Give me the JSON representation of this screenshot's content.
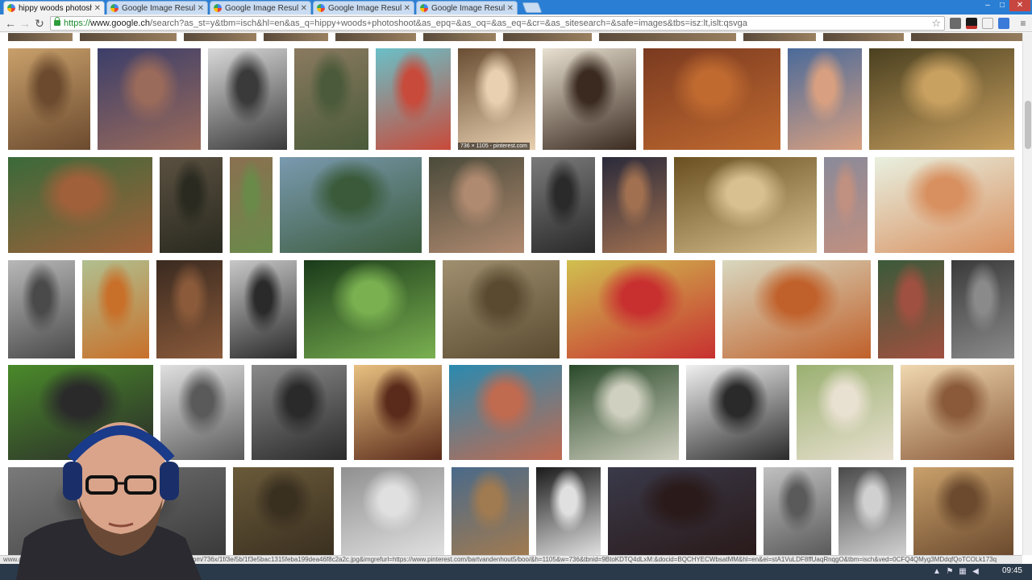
{
  "browser": {
    "tabs": [
      {
        "label": "hippy woods photoshoot",
        "active": true
      },
      {
        "label": "Google Image Result for",
        "active": false
      },
      {
        "label": "Google Image Result for",
        "active": false
      },
      {
        "label": "Google Image Result for",
        "active": false
      },
      {
        "label": "Google Image Result for",
        "active": false
      }
    ],
    "address": {
      "scheme": "https://",
      "host": "www.google.ch",
      "path": "/search?as_st=y&tbm=isch&hl=en&as_q=hippy+woods+photoshoot&as_epq=&as_oq=&as_eq=&cr=&as_sitesearch=&safe=images&tbs=isz:lt,islt:qsvga"
    },
    "window_controls": [
      "–",
      "□",
      "✕"
    ],
    "icons": [
      "back-arrow-icon",
      "reload-icon",
      "star-icon",
      "menu-icon"
    ]
  },
  "results": {
    "caption_text": "736 × 1105 - pinterest.com",
    "status_url": "www.google.ch/imgres?imgurl=https://s-media-cache-ak0.pinimg.com/736x/1f/3e/5b/1f3e5bac1315feba199dea46f8c2a2c.jpg&imgrefurl=https://www.pinterest.com/bartvandenhout5/boo/&h=1105&w=736&tbnid=9BtoKDTQ4dLxM:&docid=BQCHYECWbsatMM&hl=en&ei=stA1VuLDF8ffUaqRnqgO&tbm=isch&ved=0CFQ4QMyg3MDdqfQoTCOLk173q",
    "thumbnails": [
      {
        "c1": "#c9a06b",
        "c2": "#6b4a2e"
      },
      {
        "c1": "#3b3e6a",
        "c2": "#9a6a5a"
      },
      {
        "c1": "#d8d8d8",
        "c2": "#3a3a3a"
      },
      {
        "c1": "#8a7a60",
        "c2": "#4a5a3a"
      },
      {
        "c1": "#6ac0c8",
        "c2": "#c84a3a"
      },
      {
        "c1": "#6a4e34",
        "c2": "#e8d0b0"
      },
      {
        "c1": "#e8e0d0",
        "c2": "#3a2a20"
      },
      {
        "c1": "#7a3a20",
        "c2": "#c06a30"
      },
      {
        "c1": "#4a6a9a",
        "c2": "#d8a080"
      },
      {
        "c1": "#4a4020",
        "c2": "#c8a060"
      },
      {
        "c1": "#3a6a3a",
        "c2": "#a0603a"
      },
      {
        "c1": "#5a5040",
        "c2": "#2a2a20"
      },
      {
        "c1": "#8a7050",
        "c2": "#6a8a4a"
      },
      {
        "c1": "#7a9ab0",
        "c2": "#3a5a3a"
      },
      {
        "c1": "#4a4a3a",
        "c2": "#b08a70"
      },
      {
        "c1": "#7a7a7a",
        "c2": "#2a2a2a"
      },
      {
        "c1": "#2a2a3a",
        "c2": "#a07050"
      },
      {
        "c1": "#6a5020",
        "c2": "#d8c090"
      },
      {
        "c1": "#8a8a9a",
        "c2": "#c09080"
      },
      {
        "c1": "#e8f0e0",
        "c2": "#d89060"
      },
      {
        "c1": "#b8b8b8",
        "c2": "#4a4a4a"
      },
      {
        "c1": "#b0c090",
        "c2": "#c8702a"
      },
      {
        "c1": "#3a2a20",
        "c2": "#8a5a3a"
      },
      {
        "c1": "#c8c8c8",
        "c2": "#2a2a2a"
      },
      {
        "c1": "#1a3a1a",
        "c2": "#7ab050"
      },
      {
        "c1": "#a09070",
        "c2": "#5a4a30"
      },
      {
        "c1": "#d0c050",
        "c2": "#c83030"
      },
      {
        "c1": "#d8d8c0",
        "c2": "#c0602a"
      },
      {
        "c1": "#3a5a3a",
        "c2": "#a05040"
      },
      {
        "c1": "#3a3a3a",
        "c2": "#8a8a8a"
      },
      {
        "c1": "#4a8a2a",
        "c2": "#2a2a2a"
      },
      {
        "c1": "#e0e0e0",
        "c2": "#5a5a5a"
      },
      {
        "c1": "#8a8a8a",
        "c2": "#2a2a2a"
      },
      {
        "c1": "#e8c080",
        "c2": "#5a2a1a"
      },
      {
        "c1": "#2a8ab0",
        "c2": "#c06a50"
      },
      {
        "c1": "#2a4a2a",
        "c2": "#d0d0c0"
      },
      {
        "c1": "#f0f0f0",
        "c2": "#2a2a2a"
      },
      {
        "c1": "#9ab070",
        "c2": "#e8e0d0"
      },
      {
        "c1": "#f0d8b0",
        "c2": "#8a5a3a"
      },
      {
        "c1": "#6a4a30",
        "c2": "#b08050"
      },
      {
        "c1": "#7a7a7a",
        "c2": "#3a3a3a"
      },
      {
        "c1": "#6a5a3a",
        "c2": "#3a3020"
      },
      {
        "c1": "#909090",
        "c2": "#e0e0e0"
      },
      {
        "c1": "#4a6a8a",
        "c2": "#a07a50"
      },
      {
        "c1": "#1a1a1a",
        "c2": "#e0e0e0"
      },
      {
        "c1": "#3a3a4a",
        "c2": "#2a1a1a"
      },
      {
        "c1": "#c0c0c0",
        "c2": "#5a5a5a"
      },
      {
        "c1": "#4a4a4a",
        "c2": "#d0d0d0"
      }
    ]
  },
  "taskbar": {
    "time": "09:45"
  }
}
